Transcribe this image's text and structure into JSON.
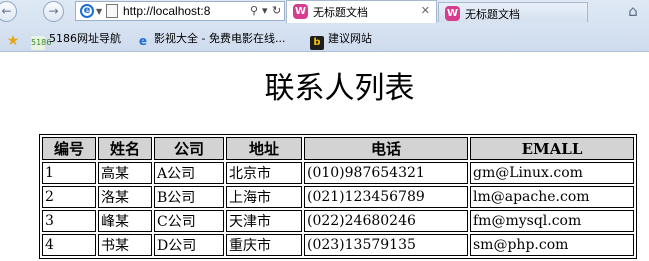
{
  "browser": {
    "address_url": "http://localhost:8",
    "tabs": [
      {
        "label": "无标题文档",
        "active": true
      },
      {
        "label": "无标题文档",
        "active": false
      }
    ],
    "favorites": [
      {
        "label": "5186网址导航",
        "icon": "5186-icon"
      },
      {
        "label": "影视大全 - 免费电影在线...",
        "icon": "ie-icon"
      },
      {
        "label": "建议网站",
        "icon": "bing-icon"
      }
    ]
  },
  "page": {
    "title": "联系人列表",
    "table": {
      "headers": [
        "编号",
        "姓名",
        "公司",
        "地址",
        "电话",
        "EMALL"
      ],
      "rows": [
        [
          "1",
          "高某",
          "A公司",
          "北京市",
          "(010)987654321",
          "gm@Linux.com"
        ],
        [
          "2",
          "洛某",
          "B公司",
          "上海市",
          "(021)123456789",
          "lm@apache.com"
        ],
        [
          "3",
          "峰某",
          "C公司",
          "天津市",
          "(022)24680246",
          "fm@mysql.com"
        ],
        [
          "4",
          "书某",
          "D公司",
          "重庆市",
          "(023)13579135",
          "sm@php.com"
        ]
      ]
    }
  },
  "colors": {
    "header_bg": "#d3d3d3",
    "chrome_bg": "#dfe9f5",
    "tab_icon": "#d83c8e"
  }
}
